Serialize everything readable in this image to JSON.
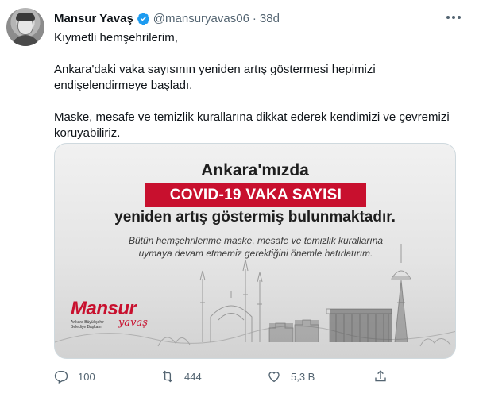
{
  "tweet": {
    "author_name": "Mansur Yavaş",
    "handle": "@mansuryavas06",
    "separator": "·",
    "time": "38d",
    "lines": [
      "Kıymetli hemşehrilerim,",
      "Ankara'daki vaka sayısının yeniden artış göstermesi hepimizi",
      "endişelendirmeye başladı.",
      "Maske, mesafe ve temizlik kurallarına dikkat ederek kendimizi ve çevremizi",
      "koruyabiliriz."
    ]
  },
  "media": {
    "headline_top": "Ankara'mızda",
    "headline_highlight": "COVID-19 VAKA SAYISI",
    "headline_bottom": "yeniden artış göstermiş bulunmaktadır.",
    "subtext_line1": "Bütün hemşehrilerime maske, mesafe ve temizlik kurallarına",
    "subtext_line2": "uymaya devam etmemiz gerektiğini önemle hatırlatırım.",
    "logo_brand": "Mansur",
    "logo_signature": "yavaş",
    "logo_tagline": "Ankara Büyükşehir Belediye Başkanı",
    "highlight_color": "#c8102e"
  },
  "actions": {
    "reply_count": "100",
    "retweet_count": "444",
    "like_count": "5,3 B",
    "icons": [
      "reply-icon",
      "retweet-icon",
      "like-icon",
      "share-icon"
    ]
  },
  "colors": {
    "verified": "#1d9bf0",
    "secondary_text": "#536471",
    "primary_text": "#0f1419"
  }
}
